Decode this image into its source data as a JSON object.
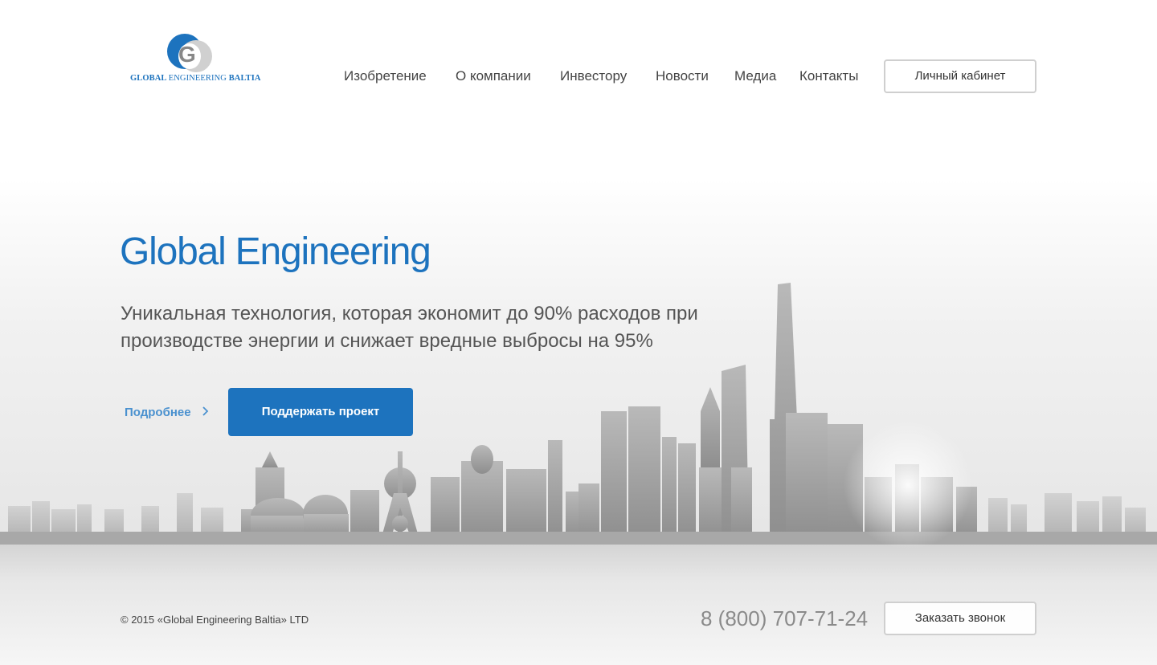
{
  "brand": {
    "logo_text_bold_1": "GLOBAL",
    "logo_text_mid": "ENGINEERING",
    "logo_text_bold_2": "BALTIA",
    "logo_letter": "G",
    "color": "#1d73be"
  },
  "nav": {
    "items": [
      {
        "label": "Изобретение"
      },
      {
        "label": "О компании"
      },
      {
        "label": "Инвестору"
      },
      {
        "label": "Новости"
      },
      {
        "label": "Медиа"
      },
      {
        "label": "Контакты"
      }
    ],
    "cabinet_label": "Личный кабинет"
  },
  "hero": {
    "title": "Global Engineering",
    "subtitle": "Уникальная технология, которая экономит до 90% расходов при производстве энергии и снижает вредные выбросы на 95%",
    "more_label": "Подробнее",
    "more_icon": "chevron-right-icon",
    "support_label": "Поддержать проект"
  },
  "footer": {
    "copyright": "© 2015 «Global Engineering Baltia» LTD",
    "phone": "8 (800) 707-71-24",
    "call_label": "Заказать звонок"
  },
  "colors": {
    "accent": "#1d73be",
    "link": "#4a91cf",
    "text": "#444444",
    "border": "#cfcfcf"
  }
}
